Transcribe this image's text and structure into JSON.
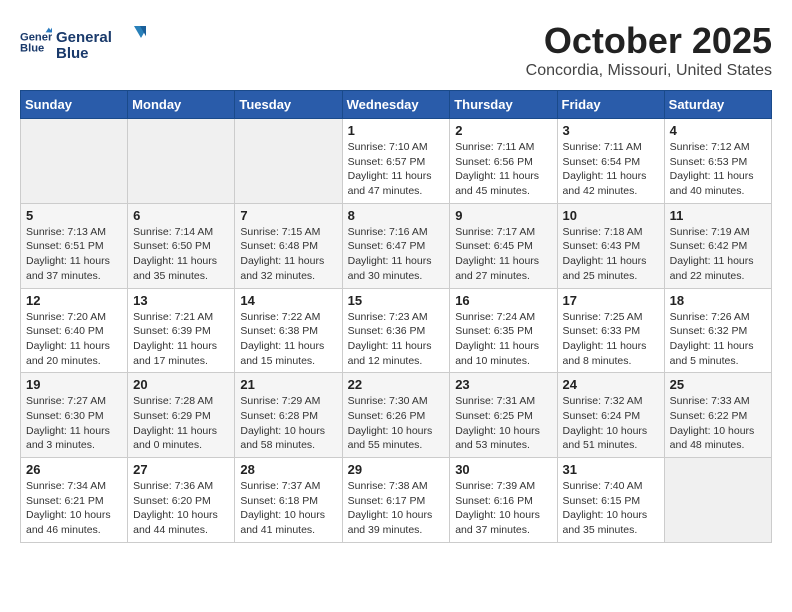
{
  "header": {
    "logo_line1": "General",
    "logo_line2": "Blue",
    "month": "October 2025",
    "location": "Concordia, Missouri, United States"
  },
  "days_of_week": [
    "Sunday",
    "Monday",
    "Tuesday",
    "Wednesday",
    "Thursday",
    "Friday",
    "Saturday"
  ],
  "weeks": [
    [
      {
        "day": "",
        "info": ""
      },
      {
        "day": "",
        "info": ""
      },
      {
        "day": "",
        "info": ""
      },
      {
        "day": "1",
        "info": "Sunrise: 7:10 AM\nSunset: 6:57 PM\nDaylight: 11 hours and 47 minutes."
      },
      {
        "day": "2",
        "info": "Sunrise: 7:11 AM\nSunset: 6:56 PM\nDaylight: 11 hours and 45 minutes."
      },
      {
        "day": "3",
        "info": "Sunrise: 7:11 AM\nSunset: 6:54 PM\nDaylight: 11 hours and 42 minutes."
      },
      {
        "day": "4",
        "info": "Sunrise: 7:12 AM\nSunset: 6:53 PM\nDaylight: 11 hours and 40 minutes."
      }
    ],
    [
      {
        "day": "5",
        "info": "Sunrise: 7:13 AM\nSunset: 6:51 PM\nDaylight: 11 hours and 37 minutes."
      },
      {
        "day": "6",
        "info": "Sunrise: 7:14 AM\nSunset: 6:50 PM\nDaylight: 11 hours and 35 minutes."
      },
      {
        "day": "7",
        "info": "Sunrise: 7:15 AM\nSunset: 6:48 PM\nDaylight: 11 hours and 32 minutes."
      },
      {
        "day": "8",
        "info": "Sunrise: 7:16 AM\nSunset: 6:47 PM\nDaylight: 11 hours and 30 minutes."
      },
      {
        "day": "9",
        "info": "Sunrise: 7:17 AM\nSunset: 6:45 PM\nDaylight: 11 hours and 27 minutes."
      },
      {
        "day": "10",
        "info": "Sunrise: 7:18 AM\nSunset: 6:43 PM\nDaylight: 11 hours and 25 minutes."
      },
      {
        "day": "11",
        "info": "Sunrise: 7:19 AM\nSunset: 6:42 PM\nDaylight: 11 hours and 22 minutes."
      }
    ],
    [
      {
        "day": "12",
        "info": "Sunrise: 7:20 AM\nSunset: 6:40 PM\nDaylight: 11 hours and 20 minutes."
      },
      {
        "day": "13",
        "info": "Sunrise: 7:21 AM\nSunset: 6:39 PM\nDaylight: 11 hours and 17 minutes."
      },
      {
        "day": "14",
        "info": "Sunrise: 7:22 AM\nSunset: 6:38 PM\nDaylight: 11 hours and 15 minutes."
      },
      {
        "day": "15",
        "info": "Sunrise: 7:23 AM\nSunset: 6:36 PM\nDaylight: 11 hours and 12 minutes."
      },
      {
        "day": "16",
        "info": "Sunrise: 7:24 AM\nSunset: 6:35 PM\nDaylight: 11 hours and 10 minutes."
      },
      {
        "day": "17",
        "info": "Sunrise: 7:25 AM\nSunset: 6:33 PM\nDaylight: 11 hours and 8 minutes."
      },
      {
        "day": "18",
        "info": "Sunrise: 7:26 AM\nSunset: 6:32 PM\nDaylight: 11 hours and 5 minutes."
      }
    ],
    [
      {
        "day": "19",
        "info": "Sunrise: 7:27 AM\nSunset: 6:30 PM\nDaylight: 11 hours and 3 minutes."
      },
      {
        "day": "20",
        "info": "Sunrise: 7:28 AM\nSunset: 6:29 PM\nDaylight: 11 hours and 0 minutes."
      },
      {
        "day": "21",
        "info": "Sunrise: 7:29 AM\nSunset: 6:28 PM\nDaylight: 10 hours and 58 minutes."
      },
      {
        "day": "22",
        "info": "Sunrise: 7:30 AM\nSunset: 6:26 PM\nDaylight: 10 hours and 55 minutes."
      },
      {
        "day": "23",
        "info": "Sunrise: 7:31 AM\nSunset: 6:25 PM\nDaylight: 10 hours and 53 minutes."
      },
      {
        "day": "24",
        "info": "Sunrise: 7:32 AM\nSunset: 6:24 PM\nDaylight: 10 hours and 51 minutes."
      },
      {
        "day": "25",
        "info": "Sunrise: 7:33 AM\nSunset: 6:22 PM\nDaylight: 10 hours and 48 minutes."
      }
    ],
    [
      {
        "day": "26",
        "info": "Sunrise: 7:34 AM\nSunset: 6:21 PM\nDaylight: 10 hours and 46 minutes."
      },
      {
        "day": "27",
        "info": "Sunrise: 7:36 AM\nSunset: 6:20 PM\nDaylight: 10 hours and 44 minutes."
      },
      {
        "day": "28",
        "info": "Sunrise: 7:37 AM\nSunset: 6:18 PM\nDaylight: 10 hours and 41 minutes."
      },
      {
        "day": "29",
        "info": "Sunrise: 7:38 AM\nSunset: 6:17 PM\nDaylight: 10 hours and 39 minutes."
      },
      {
        "day": "30",
        "info": "Sunrise: 7:39 AM\nSunset: 6:16 PM\nDaylight: 10 hours and 37 minutes."
      },
      {
        "day": "31",
        "info": "Sunrise: 7:40 AM\nSunset: 6:15 PM\nDaylight: 10 hours and 35 minutes."
      },
      {
        "day": "",
        "info": ""
      }
    ]
  ]
}
